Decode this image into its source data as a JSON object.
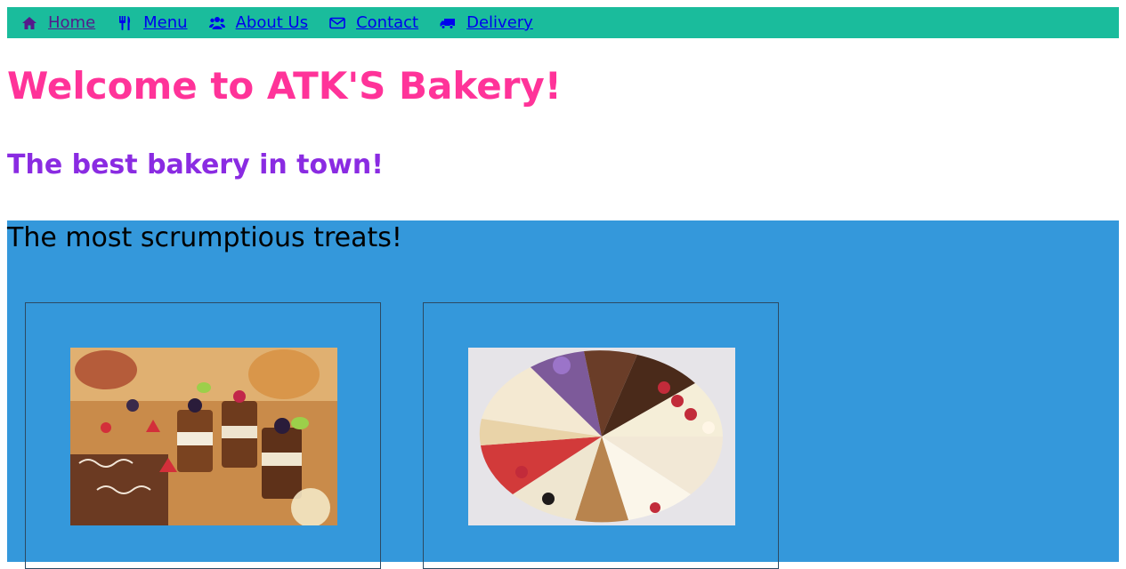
{
  "nav": {
    "items": [
      {
        "label": "Home",
        "icon": "home-icon"
      },
      {
        "label": "Menu",
        "icon": "utensils-icon"
      },
      {
        "label": "About Us",
        "icon": "users-icon"
      },
      {
        "label": "Contact",
        "icon": "envelope-icon"
      },
      {
        "label": "Delivery",
        "icon": "truck-icon"
      }
    ]
  },
  "header": {
    "title": "Welcome to ATK'S Bakery!",
    "subtitle": "The best bakery in town!"
  },
  "treats": {
    "heading": "The most scrumptious treats!",
    "images": [
      {
        "name": "desserts-display-image"
      },
      {
        "name": "cake-slices-image"
      }
    ]
  },
  "colors": {
    "nav_bg": "#1abc9c",
    "title": "#ff3399",
    "subtitle": "#8a2be2",
    "section_bg": "#3498db"
  }
}
